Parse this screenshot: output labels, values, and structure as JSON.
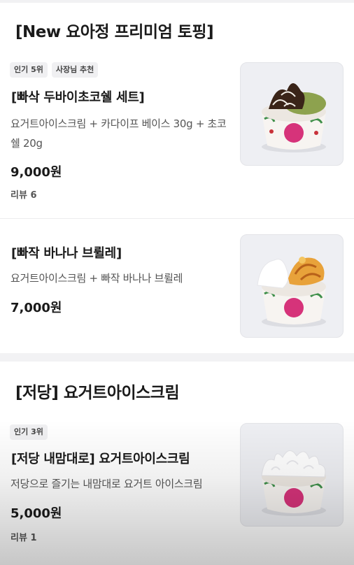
{
  "sections": [
    {
      "title": "[New 요아정 프리미엄 토핑]",
      "items": [
        {
          "badges": [
            "인기 5위",
            "사장님 추천"
          ],
          "name": "[빠삭 두바이초코쉘 세트]",
          "desc": "요거트아이스크림 + 카다이프 베이스 30g + 초코쉘 20g",
          "price": "9,000원",
          "review": "리뷰 6",
          "image": "dubai-choco-cup-image"
        },
        {
          "badges": [],
          "name": "[빠작 바나나 브륄레]",
          "desc": "요거트아이스크림 + 빠작 바나나 브륄레",
          "price": "7,000원",
          "review": "",
          "image": "banana-brulee-cup-image"
        }
      ]
    },
    {
      "title": "[저당] 요거트아이스크림",
      "items": [
        {
          "badges": [
            "인기 3위"
          ],
          "name": "[저당 내맘대로] 요거트아이스크림",
          "desc": "저당으로 즐기는 내맘대로 요거트 아이스크림",
          "price": "5,000원",
          "review": "리뷰 1",
          "image": "plain-yogurt-cup-image"
        }
      ]
    }
  ],
  "colors": {
    "cup_logo": "#d6337a",
    "cup_leaf": "#3f8f4a",
    "pistachio": "#8da24e",
    "chocolate": "#3a2418",
    "caramel": "#e8a23a"
  }
}
